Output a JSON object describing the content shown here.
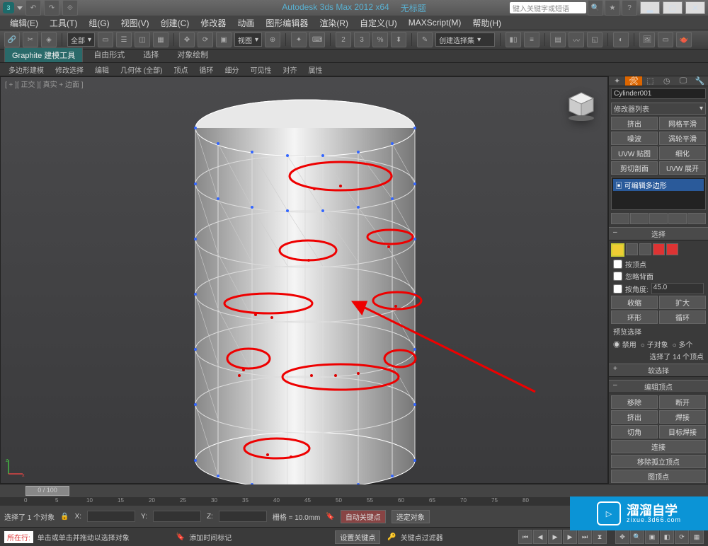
{
  "title": {
    "app": "Autodesk 3ds Max  2012 x64",
    "doc": "无标题"
  },
  "search_placeholder": "键入关键字或短语",
  "menu": [
    "编辑(E)",
    "工具(T)",
    "组(G)",
    "视图(V)",
    "创建(C)",
    "修改器",
    "动画",
    "图形编辑器",
    "渲染(R)",
    "自定义(U)",
    "MAXScript(M)",
    "帮助(H)"
  ],
  "toolbar": {
    "scope": "全部",
    "viewlabel": "视图",
    "angle_label": "3",
    "create_sel": "创建选择集"
  },
  "ribbon": {
    "tabs": [
      "Graphite 建模工具",
      "自由形式",
      "选择",
      "对象绘制"
    ],
    "sub": [
      "多边形建模",
      "修改选择",
      "编辑",
      "几何体 (全部)",
      "顶点",
      "循环",
      "细分",
      "可见性",
      "对齐",
      "属性"
    ]
  },
  "viewport_label": "[ + ][ 正交 ][ 真实 + 边面 ]",
  "object_name": "Cylinder001",
  "modifier_list": "修改器列表",
  "mod_buttons": [
    [
      "挤出",
      "网格平滑"
    ],
    [
      "噪波",
      "涡轮平滑"
    ],
    [
      "UVW 贴图",
      "细化"
    ],
    [
      "剪切剖面",
      "UVW 展开"
    ]
  ],
  "stack_item": "可编辑多边形",
  "section_select": "选择",
  "chk_vert": "按顶点",
  "chk_back": "忽略背面",
  "chk_angle": "按角度:",
  "angle_val": "45.0",
  "btn_shrink": "收缩",
  "btn_grow": "扩大",
  "btn_ring": "环形",
  "btn_loop": "循环",
  "preview_sel": "预览选择",
  "radios": [
    "禁用",
    "子对象",
    "多个"
  ],
  "sel_count": "选择了 14 个顶点",
  "section_soft": "软选择",
  "section_edit": "编辑顶点",
  "edit_btns": [
    [
      "移除",
      "断开"
    ],
    [
      "挤出",
      "焊接"
    ],
    [
      "切角",
      "目标焊接"
    ]
  ],
  "btn_connect": "连接",
  "btn_iso": "移除孤立顶点",
  "btn_unused": "图顶点",
  "timeline": {
    "thumb": "0 / 100",
    "ticks": [
      "0",
      "5",
      "10",
      "15",
      "20",
      "25",
      "30",
      "35",
      "40",
      "45",
      "50",
      "55",
      "60",
      "65",
      "70",
      "75",
      "80"
    ]
  },
  "status": {
    "sel": "选择了 1 个对象",
    "x": "X:",
    "y": "Y:",
    "z": "Z:",
    "grid": "栅格 = 10.0mm",
    "autokey": "自动关键点",
    "selfilter": "选定对象"
  },
  "bottom": {
    "tag": "所在行:",
    "hint": "单击或单击并拖动以选择对象",
    "addtime": "添加时间标记",
    "setkey": "设置关键点",
    "keyfilter": "关键点过滤器"
  },
  "watermark": {
    "main": "溜溜自学",
    "sub": "zixue.3d66.com"
  }
}
